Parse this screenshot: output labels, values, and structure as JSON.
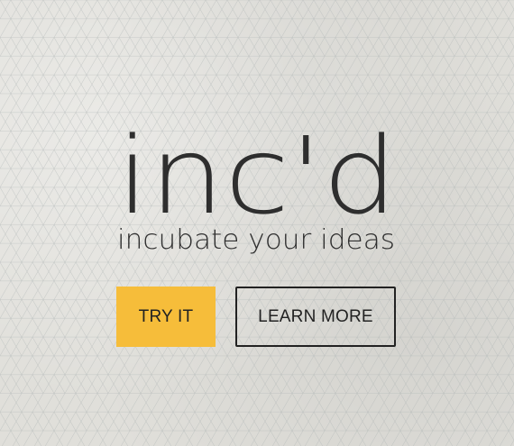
{
  "brand": {
    "logo_text": "inc'd",
    "tagline": "incubate your ideas"
  },
  "actions": {
    "try_label": "TRY IT",
    "learn_label": "LEARN MORE"
  },
  "colors": {
    "background": "#e2e1dc",
    "accent": "#f6bd3a",
    "text": "#2b2b2b"
  }
}
